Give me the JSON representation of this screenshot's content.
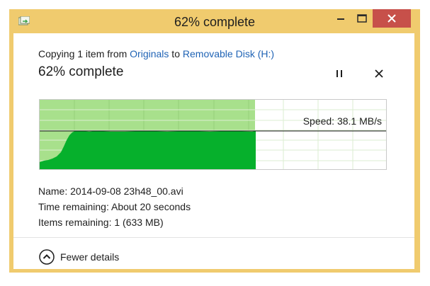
{
  "window": {
    "title": "62% complete",
    "frame_color": "#f0cb6e",
    "close_color": "#c7504a"
  },
  "copy": {
    "prefix": "Copying 1 item from ",
    "source": "Originals",
    "to": " to ",
    "destination": "Removable Disk (H:)"
  },
  "progress": {
    "heading": "62% complete",
    "fraction": 0.62,
    "speed_label": "Speed: 38.1 MB/s"
  },
  "details": {
    "name_label": "Name:",
    "name_value": "2014-09-08 23h48_00.avi",
    "time_label": "Time remaining:",
    "time_value": "About 20 seconds",
    "items_label": "Items remaining:",
    "items_value": "1 (633 MB)"
  },
  "footer": {
    "toggle_label": "Fewer details"
  },
  "colors": {
    "link": "#1f63b5",
    "graph_done": "#a8e08c",
    "graph_fill": "#06b02c"
  },
  "icons": [
    "copy-app-icon",
    "minimize-icon",
    "maximize-icon",
    "close-icon",
    "pause-icon",
    "cancel-icon",
    "chevron-up-icon"
  ]
}
